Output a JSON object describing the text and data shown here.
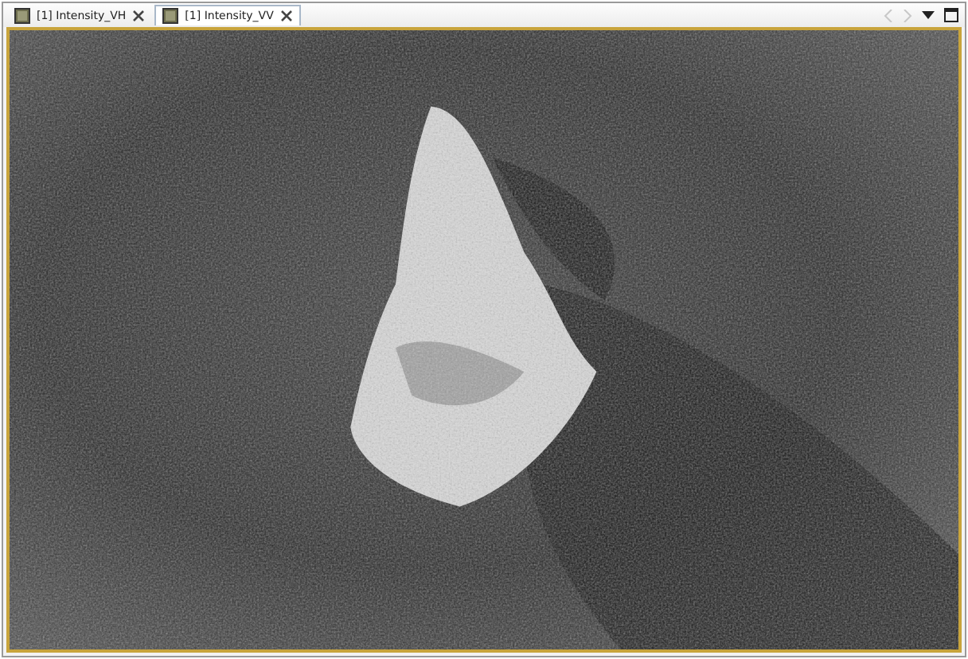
{
  "tabs": [
    {
      "label": "[1] Intensity_VH",
      "selected": false
    },
    {
      "label": "[1] Intensity_VV",
      "selected": true
    }
  ],
  "nav": {
    "back_disabled": true,
    "forward_disabled": true
  }
}
